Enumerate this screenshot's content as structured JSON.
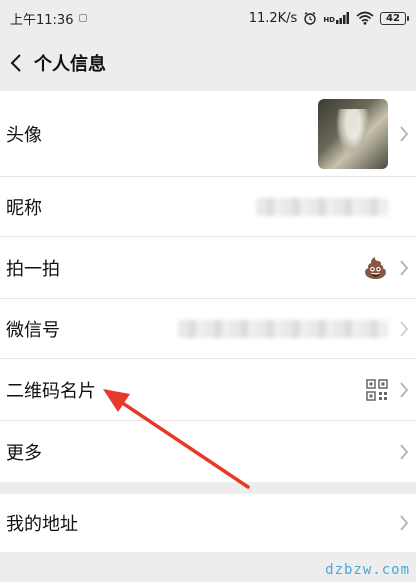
{
  "status_bar": {
    "time": "上午11:36",
    "speed": "11.2K/s",
    "network": "HD",
    "battery": "42"
  },
  "nav": {
    "title": "个人信息"
  },
  "rows": [
    {
      "label": "头像"
    },
    {
      "label": "昵称"
    },
    {
      "label": "拍一拍",
      "emoji": "💩"
    },
    {
      "label": "微信号"
    },
    {
      "label": "二维码名片"
    },
    {
      "label": "更多"
    }
  ],
  "address_row": {
    "label": "我的地址"
  },
  "annotation": {
    "arrow_color": "#e8372b"
  },
  "watermark": "dzbzw.com"
}
